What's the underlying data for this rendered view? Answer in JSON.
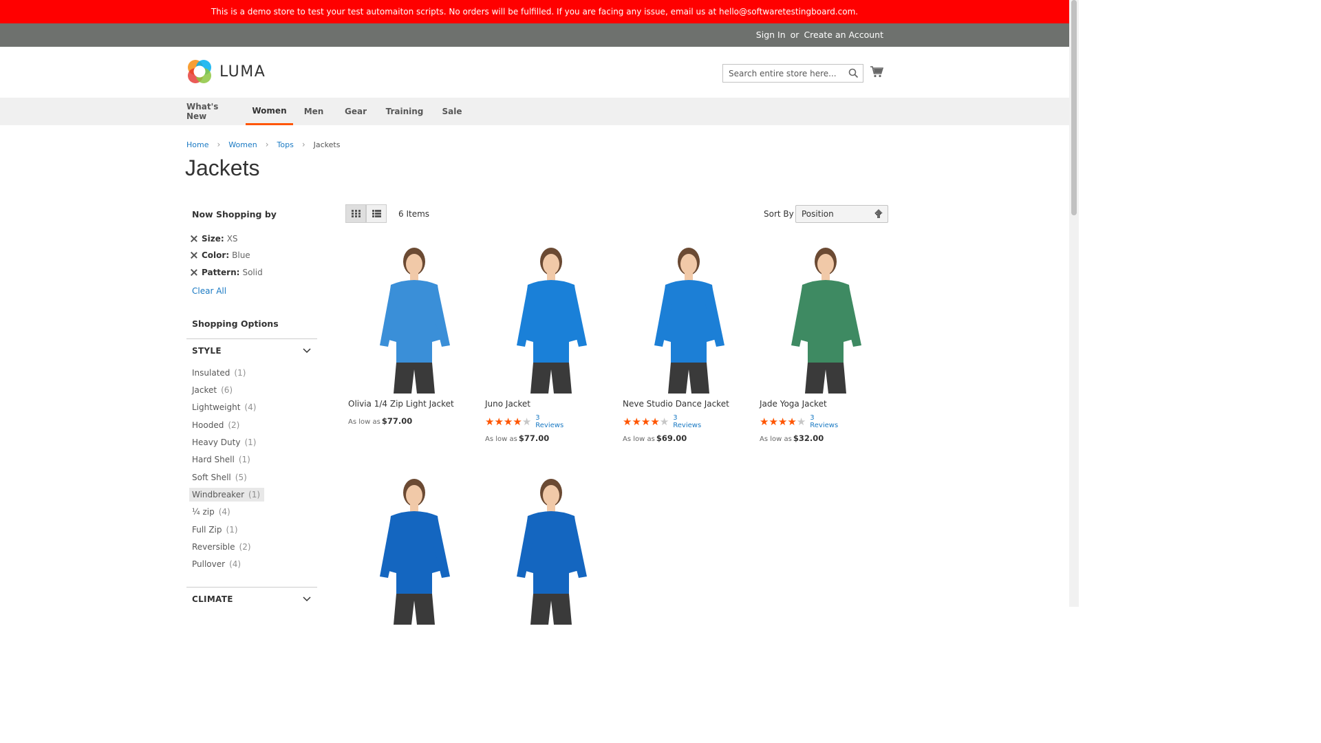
{
  "demo_notice": "This is a demo store to test your test automaiton scripts. No orders will be fulfilled. If you are facing any issue, email us at hello@softwaretestingboard.com.",
  "top_links": {
    "sign_in": "Sign In",
    "or": "or",
    "create_account": "Create an Account"
  },
  "header": {
    "logo_text": "LUMA",
    "search_placeholder": "Search entire store here..."
  },
  "nav": [
    "What's New",
    "Women",
    "Men",
    "Gear",
    "Training",
    "Sale"
  ],
  "breadcrumb": [
    "Home",
    "Women",
    "Tops",
    "Jackets"
  ],
  "page_title": "Jackets",
  "now_shopping": {
    "heading": "Now Shopping by",
    "filters": [
      {
        "name": "Size:",
        "value": "XS"
      },
      {
        "name": "Color:",
        "value": "Blue"
      },
      {
        "name": "Pattern:",
        "value": "Solid"
      }
    ],
    "clear_all": "Clear All"
  },
  "shopping_options": {
    "heading": "Shopping Options",
    "style_title": "STYLE",
    "style_options": [
      {
        "label": "Insulated",
        "count": "(1)"
      },
      {
        "label": "Jacket",
        "count": "(6)"
      },
      {
        "label": "Lightweight",
        "count": "(4)"
      },
      {
        "label": "Hooded",
        "count": "(2)"
      },
      {
        "label": "Heavy Duty",
        "count": "(1)"
      },
      {
        "label": "Hard Shell",
        "count": "(1)"
      },
      {
        "label": "Soft Shell",
        "count": "(5)"
      },
      {
        "label": "Windbreaker",
        "count": "(1)"
      },
      {
        "label": "¼ zip",
        "count": "(4)"
      },
      {
        "label": "Full Zip",
        "count": "(1)"
      },
      {
        "label": "Reversible",
        "count": "(2)"
      },
      {
        "label": "Pullover",
        "count": "(4)"
      }
    ],
    "climate_title": "CLIMATE"
  },
  "toolbar": {
    "items_count": "6 Items",
    "sort_label": "Sort By",
    "sort_value": "Position"
  },
  "products": [
    {
      "name": "Olivia 1/4 Zip Light Jacket",
      "price_prefix": "As low as",
      "price": "$77.00",
      "rating": null,
      "reviews": null,
      "shirt_color": "#3a8fd8"
    },
    {
      "name": "Juno Jacket",
      "price_prefix": "As low as",
      "price": "$77.00",
      "rating": 4,
      "reviews": "3 Reviews",
      "shirt_color": "#1a80d8"
    },
    {
      "name": "Neve Studio Dance Jacket",
      "price_prefix": "As low as",
      "price": "$69.00",
      "rating": 4,
      "reviews": "3 Reviews",
      "shirt_color": "#1c7fd6"
    },
    {
      "name": "Jade Yoga Jacket",
      "price_prefix": "As low as",
      "price": "$32.00",
      "rating": 4,
      "reviews": "3 Reviews",
      "shirt_color": "#3e8a62"
    },
    {
      "name": "",
      "price_prefix": "",
      "price": "",
      "rating": null,
      "reviews": null,
      "shirt_color": "#1466c0"
    },
    {
      "name": "",
      "price_prefix": "",
      "price": "",
      "rating": null,
      "reviews": null,
      "shirt_color": "#1466c0"
    }
  ],
  "colors": {
    "demo_bar": "#ff0000",
    "link": "#1979c3",
    "accent": "#ff5501"
  }
}
